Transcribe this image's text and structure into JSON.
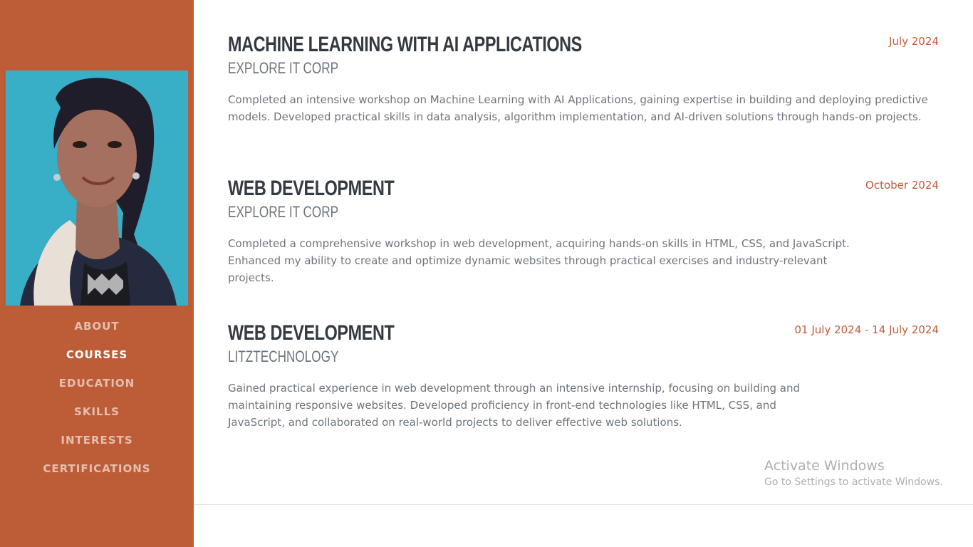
{
  "nav": {
    "items": [
      {
        "label": "ABOUT"
      },
      {
        "label": "COURSES"
      },
      {
        "label": "EDUCATION"
      },
      {
        "label": "SKILLS"
      },
      {
        "label": "INTERESTS"
      },
      {
        "label": "CERTIFICATIONS"
      }
    ],
    "active": "COURSES"
  },
  "entries": [
    {
      "title": "MACHINE LEARNING WITH AI APPLICATIONS",
      "subtitle": "EXPLORE IT CORP",
      "date": "July 2024",
      "description": "Completed an intensive workshop on Machine Learning with AI Applications, gaining expertise in building and deploying predictive models. Developed practical skills in data analysis, algorithm implementation, and AI-driven solutions through hands-on projects."
    },
    {
      "title": "WEB DEVELOPMENT",
      "subtitle": "EXPLORE IT CORP",
      "date": "October 2024",
      "description": "Completed a comprehensive workshop in web development, acquiring hands-on skills in HTML, CSS, and JavaScript. Enhanced my ability to create and optimize dynamic websites through practical exercises and industry-relevant projects."
    },
    {
      "title": "WEB DEVELOPMENT",
      "subtitle": "LITZTECHNOLOGY",
      "date": "01 July 2024 - 14 July 2024",
      "description": "Gained practical experience in web development through an intensive internship, focusing on building and maintaining responsive websites. Developed proficiency in front-end technologies like HTML, CSS, and JavaScript, and collaborated on real-world projects to deliver effective web solutions."
    }
  ],
  "watermark": {
    "title": "Activate Windows",
    "subtitle": "Go to Settings to activate Windows."
  },
  "colors": {
    "sidebar": "#bd5d38",
    "accent": "#bd5d38",
    "heading": "#343a40",
    "muted": "#6c757d"
  }
}
